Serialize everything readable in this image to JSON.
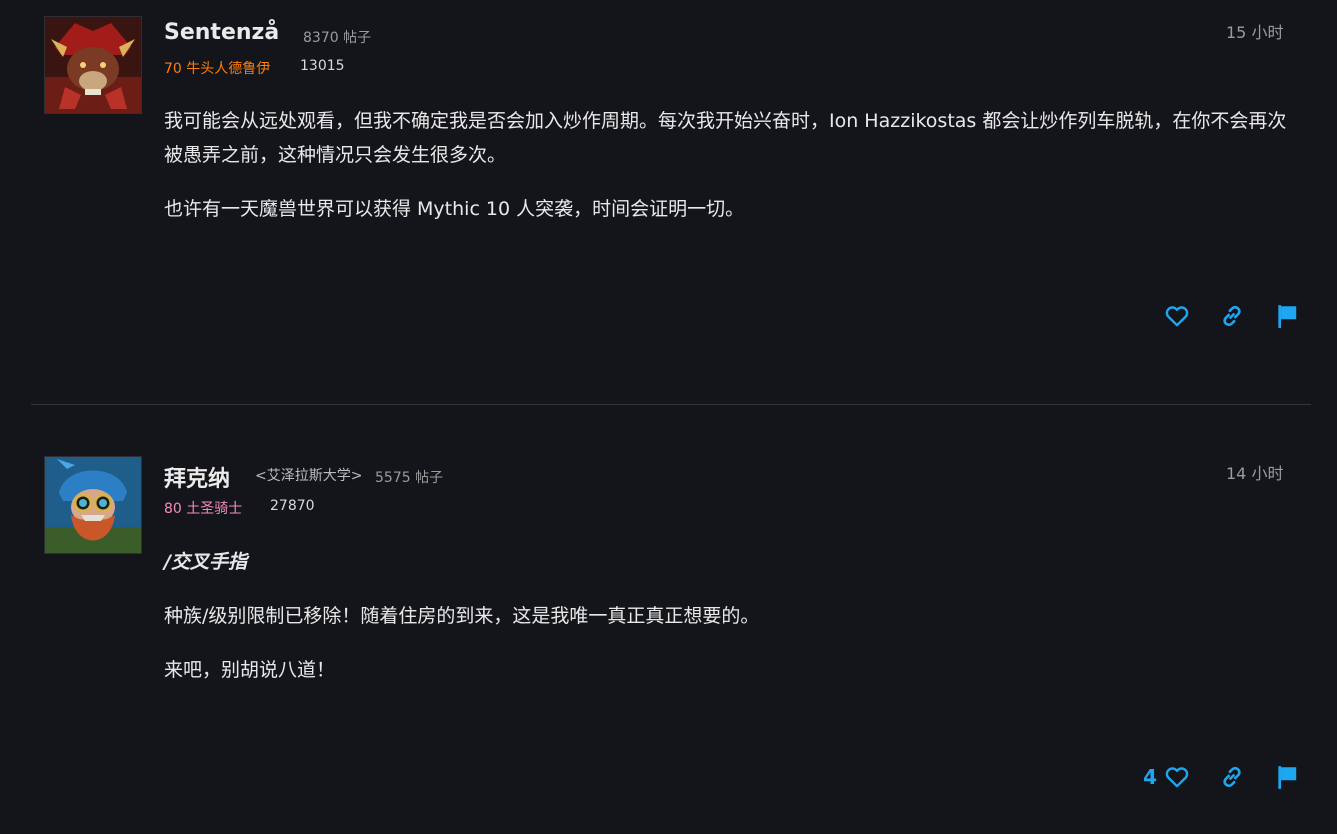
{
  "posts": [
    {
      "author": "Sentenzå",
      "guild": "",
      "post_count": "8370 帖子",
      "character": "70 牛头人德鲁伊",
      "achievement_points": "13015",
      "timestamp": "15 小时",
      "class_color": "#ff7d0a",
      "paragraphs": [
        "我可能会从远处观看，但我不确定我是否会加入炒作周期。每次我开始兴奋时，Ion Hazzikostas 都会让炒作列车脱轨，在你不会再次被愚弄之前，这种情况只会发生很多次。",
        "也许有一天魔兽世界可以获得 Mythic 10 人突袭，时间会证明一切。"
      ],
      "likes": "",
      "icons": [
        "heart-icon",
        "link-icon",
        "flag-icon"
      ]
    },
    {
      "author": "拜克纳",
      "guild": "<艾泽拉斯大学>",
      "post_count": "5575 帖子",
      "character": "80 土圣骑士",
      "achievement_points": "27870",
      "timestamp": "14 小时",
      "class_color": "#f58cba",
      "emote": "/交叉手指",
      "paragraphs": [
        "种族/级别限制已移除！随着住房的到来，这是我唯一真正真正想要的。",
        "来吧，别胡说八道！"
      ],
      "likes": "4",
      "icons": [
        "heart-icon",
        "link-icon",
        "flag-icon"
      ]
    }
  ],
  "colors": {
    "background": "#14151b",
    "accent": "#1ea7f0",
    "divider": "#34363c"
  }
}
